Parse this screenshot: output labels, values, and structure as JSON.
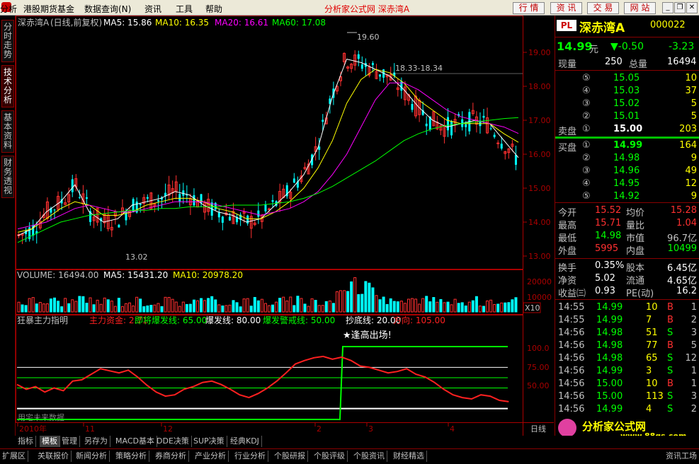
{
  "menubar": {
    "items": [
      "分析",
      "港股期货基金",
      "数据查询(N)",
      "资讯",
      "工具",
      "帮助"
    ],
    "site_title": "分析家公式网 深赤湾A",
    "buttons": [
      "行 情",
      "资 讯",
      "交 易",
      "网 站"
    ]
  },
  "left_tabs": [
    "分时走势",
    "技术分析",
    "基本资料",
    "财务透视"
  ],
  "chart": {
    "header": {
      "stock": "深赤湾A",
      "mode": "(日线,前复权)",
      "ma5": "MA5: 15.86",
      "ma10": "MA10: 16.35",
      "ma20": "MA20: 16.61",
      "ma60": "MA60: 17.08"
    },
    "price_axis": [
      "19.00",
      "18.00",
      "17.00",
      "16.00",
      "15.00",
      "14.00",
      "13.00"
    ],
    "annotations": {
      "high": "19.60",
      "low": "13.02",
      "range": "18.33-18.34"
    },
    "volume_header": {
      "volume": "VOLUME: 16494.00",
      "ma5": "MA5: 15431.20",
      "ma10": "MA10: 20978.20"
    },
    "volume_axis": [
      "20000",
      "10000"
    ],
    "volume_unit": "X10",
    "indicator_header": {
      "name": "狂暴主力指明",
      "fund": "主力资金: 2.71",
      "l1": "即将爆发线: 65.00",
      "l2": "爆发线: 80.00",
      "l3": "爆发警戒线: 50.00",
      "l4": "抄底线: 20.00",
      "l5": "方向: 105.00"
    },
    "indicator_axis": [
      "100.0",
      "75.00",
      "50.00"
    ],
    "indicator_note": "★逢高出场!",
    "indicator_future": "用宅未来数据",
    "date_axis": [
      "2010年",
      "11",
      "12",
      "2",
      "3",
      "4"
    ],
    "period": "日线"
  },
  "chart_data": {
    "type": "line",
    "title": "深赤湾A (日线,前复权)",
    "xlabel": "",
    "ylabel": "",
    "ylim": [
      12.7,
      19.9
    ],
    "series": [
      {
        "name": "MA5",
        "color": "#ffffff",
        "values": [
          13.6,
          13.8,
          14.3,
          14.6,
          15.1,
          14.3,
          14.0,
          14.1,
          14.5,
          14.6,
          14.7,
          14.9,
          14.8,
          14.5,
          14.3,
          14.2,
          14.0,
          14.1,
          14.5,
          14.9,
          15.4,
          16.2,
          17.7,
          18.8,
          18.7,
          18.5,
          18.3,
          17.9,
          17.4,
          17.0,
          16.8,
          16.9,
          17.0,
          16.9,
          16.4,
          15.9
        ]
      },
      {
        "name": "MA10",
        "color": "#ffff00",
        "values": [
          13.7,
          13.8,
          14.1,
          14.4,
          14.6,
          14.5,
          14.2,
          14.2,
          14.3,
          14.5,
          14.6,
          14.7,
          14.7,
          14.6,
          14.4,
          14.3,
          14.1,
          14.1,
          14.3,
          14.6,
          15.0,
          15.6,
          16.4,
          17.5,
          18.2,
          18.5,
          18.4,
          18.1,
          17.6,
          17.3,
          17.0,
          16.9,
          16.9,
          16.9,
          16.6,
          16.35
        ]
      },
      {
        "name": "MA20",
        "color": "#ff00ff",
        "values": [
          13.8,
          13.9,
          14.0,
          14.2,
          14.4,
          14.5,
          14.4,
          14.3,
          14.3,
          14.4,
          14.5,
          14.6,
          14.6,
          14.6,
          14.5,
          14.4,
          14.3,
          14.2,
          14.3,
          14.4,
          14.6,
          14.9,
          15.4,
          16.0,
          16.8,
          17.6,
          18.1,
          18.1,
          17.9,
          17.6,
          17.3,
          17.1,
          17.0,
          16.9,
          16.8,
          16.61
        ]
      },
      {
        "name": "MA60",
        "color": "#00ff00",
        "values": [
          13.4,
          13.6,
          13.8,
          14.0,
          14.1,
          14.2,
          14.25,
          14.3,
          14.35,
          14.35,
          14.4,
          14.4,
          14.45,
          14.45,
          14.45,
          14.5,
          14.5,
          14.5,
          14.55,
          14.6,
          14.7,
          14.85,
          15.05,
          15.3,
          15.55,
          15.8,
          16.1,
          16.4,
          16.6,
          16.75,
          16.85,
          16.9,
          16.95,
          17.0,
          17.05,
          17.08
        ]
      }
    ]
  },
  "quote": {
    "badge": "PL",
    "name": "深赤湾A",
    "code": "000022",
    "price": "14.99",
    "price_unit": "元",
    "change": "▼-0.50",
    "pct": "-3.23",
    "cur_vol_label": "现量",
    "cur_vol": "250",
    "total_label": "总量",
    "total": "16494",
    "sell": [
      {
        "idx": "⑤",
        "price": "15.05",
        "vol": "10"
      },
      {
        "idx": "④",
        "price": "15.03",
        "vol": "37"
      },
      {
        "idx": "③",
        "price": "15.02",
        "vol": "5"
      },
      {
        "idx": "②",
        "price": "15.01",
        "vol": "5"
      },
      {
        "idx": "①",
        "price": "15.00",
        "vol": "203",
        "label": "卖盘"
      }
    ],
    "buy": [
      {
        "idx": "①",
        "price": "14.99",
        "vol": "164",
        "label": "买盘"
      },
      {
        "idx": "②",
        "price": "14.98",
        "vol": "9"
      },
      {
        "idx": "③",
        "price": "14.96",
        "vol": "49"
      },
      {
        "idx": "④",
        "price": "14.95",
        "vol": "12"
      },
      {
        "idx": "⑤",
        "price": "14.92",
        "vol": "9"
      }
    ],
    "stats": [
      {
        "l1": "今开",
        "v1": "15.52",
        "l2": "均价",
        "v2": "15.28"
      },
      {
        "l1": "最高",
        "v1": "15.71",
        "l2": "量比",
        "v2": "1.04"
      },
      {
        "l1": "最低",
        "v1": "14.98",
        "l2": "市值",
        "v2": "96.7亿"
      },
      {
        "l1": "外盘",
        "v1": "5995",
        "l2": "内盘",
        "v2": "10499"
      }
    ],
    "fund": [
      {
        "l1": "换手",
        "v1": "0.35%",
        "l2": "股本",
        "v2": "6.45亿"
      },
      {
        "l1": "净资",
        "v1": "5.02",
        "l2": "流通",
        "v2": "4.65亿"
      },
      {
        "l1": "收益㈢",
        "v1": "0.93",
        "l2": "PE(动)",
        "v2": "16.2"
      }
    ],
    "ticks": [
      {
        "t": "14:55",
        "p": "14.99",
        "v": "10",
        "s": "B",
        "n": "1"
      },
      {
        "t": "14:55",
        "p": "14.99",
        "v": "7",
        "s": "B",
        "n": "2"
      },
      {
        "t": "14:56",
        "p": "14.98",
        "v": "51",
        "s": "S",
        "n": "3"
      },
      {
        "t": "14:56",
        "p": "14.98",
        "v": "77",
        "s": "B",
        "n": "5"
      },
      {
        "t": "14:56",
        "p": "14.98",
        "v": "65",
        "s": "S",
        "n": "12"
      },
      {
        "t": "14:56",
        "p": "14.99",
        "v": "3",
        "s": "S",
        "n": "1"
      },
      {
        "t": "14:56",
        "p": "15.00",
        "v": "10",
        "s": "B",
        "n": "1"
      },
      {
        "t": "14:56",
        "p": "15.00",
        "v": "113",
        "s": "S",
        "n": "3"
      },
      {
        "t": "14:56",
        "p": "14.99",
        "v": "4",
        "s": "S",
        "n": "2"
      }
    ]
  },
  "tabs_row1": [
    "指标",
    "模板",
    "管理",
    "另存为",
    "MACD基本",
    "DDE决策",
    "SUP决策",
    "经典KDJ"
  ],
  "tabs_row2": [
    "扩展区",
    "关联报价",
    "新闻分析",
    "策略分析",
    "券商分析",
    "产业分析",
    "行业分析",
    "个股研报",
    "个股评级",
    "个股资讯",
    "财经精选",
    "资讯工场"
  ],
  "watermark": {
    "title": "分析家公式网",
    "url": "www.88gs.com"
  }
}
